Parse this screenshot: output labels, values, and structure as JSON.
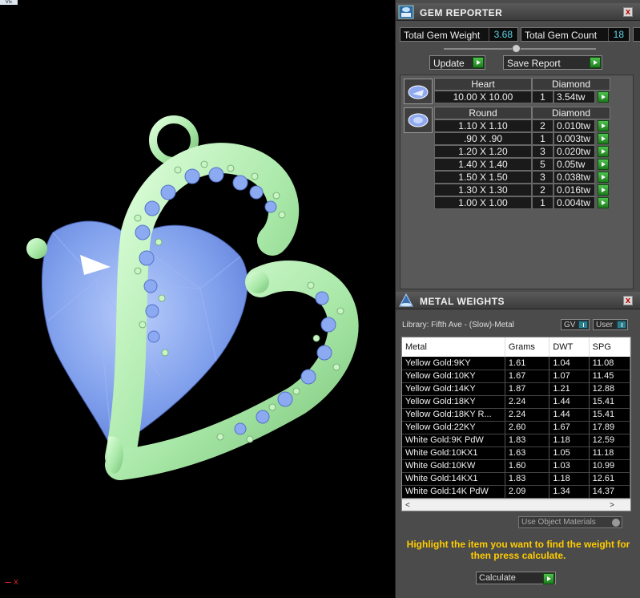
{
  "viewport": {
    "corner_tab": "VE",
    "axis_label": "x"
  },
  "gem_reporter": {
    "title": "GEM REPORTER",
    "close": "x",
    "total_weight_label": "Total Gem Weight",
    "total_weight_value": "3.68",
    "total_count_label": "Total Gem Count",
    "total_count_value": "18",
    "update_label": "Update",
    "save_report_label": "Save Report",
    "groups": [
      {
        "shape": "Heart",
        "type": "Diamond",
        "rows": [
          {
            "size": "10.00 X 10.00",
            "count": "1",
            "weight": "3.54tw"
          }
        ]
      },
      {
        "shape": "Round",
        "type": "Diamond",
        "rows": [
          {
            "size": "1.10 X 1.10",
            "count": "2",
            "weight": "0.010tw"
          },
          {
            "size": ".90 X .90",
            "count": "1",
            "weight": "0.003tw"
          },
          {
            "size": "1.20 X 1.20",
            "count": "3",
            "weight": "0.020tw"
          },
          {
            "size": "1.40 X 1.40",
            "count": "5",
            "weight": "0.05tw"
          },
          {
            "size": "1.50 X 1.50",
            "count": "3",
            "weight": "0.038tw"
          },
          {
            "size": "1.30 X 1.30",
            "count": "2",
            "weight": "0.016tw"
          },
          {
            "size": "1.00 X 1.00",
            "count": "1",
            "weight": "0.004tw"
          }
        ]
      }
    ]
  },
  "metal_weights": {
    "title": "METAL WEIGHTS",
    "close": "x",
    "library": "Library: Fifth Ave - (Slow)-Metal",
    "gv_label": "GV",
    "user_label": "User",
    "columns": [
      "Metal",
      "Grams",
      "DWT",
      "SPG"
    ],
    "rows": [
      [
        "Yellow Gold:9KY",
        "1.61",
        "1.04",
        "11.08"
      ],
      [
        "Yellow Gold:10KY",
        "1.67",
        "1.07",
        "11.45"
      ],
      [
        "Yellow Gold:14KY",
        "1.87",
        "1.21",
        "12.88"
      ],
      [
        "Yellow Gold:18KY",
        "2.24",
        "1.44",
        "15.41"
      ],
      [
        "Yellow Gold:18KY R...",
        "2.24",
        "1.44",
        "15.41"
      ],
      [
        "Yellow Gold:22KY",
        "2.60",
        "1.67",
        "17.89"
      ],
      [
        "White Gold:9K PdW",
        "1.83",
        "1.18",
        "12.59"
      ],
      [
        "White Gold:10KX1",
        "1.63",
        "1.05",
        "11.18"
      ],
      [
        "White Gold:10KW",
        "1.60",
        "1.03",
        "10.99"
      ],
      [
        "White Gold:14KX1",
        "1.83",
        "1.18",
        "12.61"
      ],
      [
        "White Gold:14K PdW",
        "2.09",
        "1.34",
        "14.37"
      ]
    ],
    "scroll_left": "<",
    "scroll_right": ">",
    "use_object_materials": "Use Object Materials",
    "instruction": "Highlight the item you want to find the weight for then press calculate.",
    "calculate_label": "Calculate"
  },
  "colors": {
    "metal": "#b6f0b6",
    "gem": "#8aa8f0",
    "accent_green": "#2fa02f",
    "value_cyan": "#5fd3e6",
    "instruction_yellow": "#ffcc00"
  }
}
